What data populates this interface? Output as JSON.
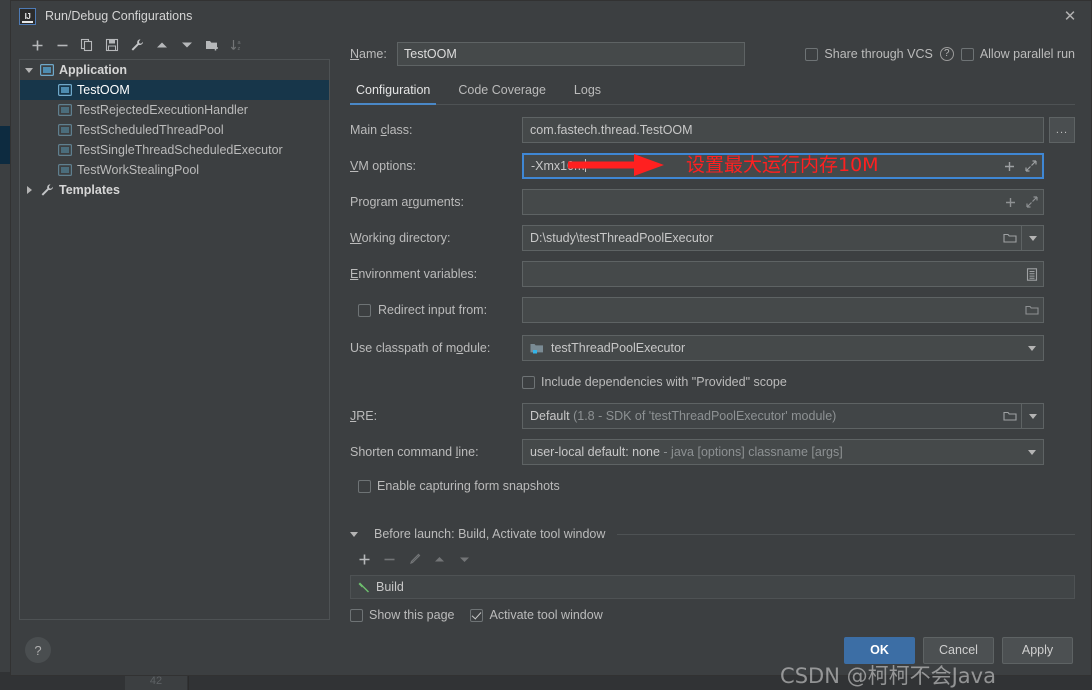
{
  "window": {
    "title": "Run/Debug Configurations",
    "logo_text": "IJ",
    "close_icon": "close-icon"
  },
  "left_toolbar": {
    "buttons": [
      {
        "name": "add-configuration-button",
        "icon": "plus-icon",
        "disabled": false
      },
      {
        "name": "remove-configuration-button",
        "icon": "minus-icon",
        "disabled": false
      },
      {
        "name": "copy-configuration-button",
        "icon": "copy-icon",
        "disabled": false
      },
      {
        "name": "save-configuration-button",
        "icon": "save-icon",
        "disabled": false
      },
      {
        "name": "edit-templates-button",
        "icon": "wrench-icon",
        "disabled": false
      },
      {
        "name": "move-up-button",
        "icon": "arrow-up-icon",
        "disabled": false
      },
      {
        "name": "move-down-button",
        "icon": "arrow-down-icon",
        "disabled": false
      },
      {
        "name": "new-folder-button",
        "icon": "folder-add-icon",
        "disabled": false
      },
      {
        "name": "sort-alphabetically-button",
        "icon": "sort-az-icon",
        "disabled": true
      }
    ]
  },
  "tree": {
    "items": [
      {
        "label": "Application",
        "level": 0,
        "type": "group",
        "expanded": true,
        "selected": false,
        "icon": "application-icon"
      },
      {
        "label": "TestOOM",
        "level": 1,
        "type": "config",
        "selected": true,
        "icon": "application-icon"
      },
      {
        "label": "TestRejectedExecutionHandler",
        "level": 1,
        "type": "config",
        "selected": false,
        "icon": "application-icon"
      },
      {
        "label": "TestScheduledThreadPool",
        "level": 1,
        "type": "config",
        "selected": false,
        "icon": "application-icon"
      },
      {
        "label": "TestSingleThreadScheduledExecutor",
        "level": 1,
        "type": "config",
        "selected": false,
        "icon": "application-icon"
      },
      {
        "label": "TestWorkStealingPool",
        "level": 1,
        "type": "config",
        "selected": false,
        "icon": "application-icon"
      },
      {
        "label": "Templates",
        "level": 0,
        "type": "group",
        "expanded": false,
        "selected": false,
        "icon": "wrench-icon"
      }
    ]
  },
  "name_row": {
    "label": "Name:",
    "value": "TestOOM",
    "share_vcs_label": "Share through VCS",
    "share_vcs_checked": false,
    "help_icon": "question-mark-icon",
    "allow_parallel_label": "Allow parallel run",
    "allow_parallel_checked": false
  },
  "tabs": [
    {
      "label": "Configuration",
      "active": true
    },
    {
      "label": "Code Coverage",
      "active": false
    },
    {
      "label": "Logs",
      "active": false
    }
  ],
  "form": {
    "main_class": {
      "label": "Main class:",
      "value": "com.fastech.thread.TestOOM",
      "browse_label": "..."
    },
    "vm_options": {
      "label": "VM options:",
      "value": "-Xmx10m",
      "focused": true,
      "macro_icon": "plus-icon",
      "expand_icon": "expand-diagonal-icon"
    },
    "program_arguments": {
      "label": "Program arguments:",
      "value": "",
      "macro_icon": "plus-icon",
      "expand_icon": "expand-diagonal-icon"
    },
    "working_directory": {
      "label": "Working directory:",
      "value": "D:\\study\\testThreadPoolExecutor",
      "browse_icon": "folder-icon",
      "dropdown_icon": "chevron-down-icon"
    },
    "environment_variables": {
      "label": "Environment variables:",
      "value": "",
      "browse_icon": "list-edit-icon"
    },
    "redirect_input": {
      "label": "Redirect input from:",
      "checked": false,
      "value": "",
      "browse_icon": "folder-icon"
    },
    "classpath_module": {
      "label": "Use classpath of module:",
      "value": "testThreadPoolExecutor",
      "icon": "module-icon",
      "dropdown_icon": "chevron-down-icon"
    },
    "include_provided": {
      "label": "Include dependencies with \"Provided\" scope",
      "checked": false
    },
    "jre": {
      "label": "JRE:",
      "value": "Default",
      "value_muted": " (1.8 - SDK of 'testThreadPoolExecutor' module)",
      "browse_icon": "folder-icon",
      "dropdown_icon": "chevron-down-icon"
    },
    "shorten_command_line": {
      "label": "Shorten command line:",
      "value": "user-local default: none",
      "value_muted": " - java [options] classname [args]",
      "dropdown_icon": "chevron-down-icon"
    },
    "form_snapshots": {
      "label": "Enable capturing form snapshots",
      "checked": false
    }
  },
  "before_launch": {
    "header": "Before launch: Build, Activate tool window",
    "expanded": true,
    "toolbar": [
      {
        "name": "add-task-button",
        "icon": "plus-icon",
        "disabled": false
      },
      {
        "name": "remove-task-button",
        "icon": "minus-icon",
        "disabled": true
      },
      {
        "name": "edit-task-button",
        "icon": "pencil-icon",
        "disabled": true
      },
      {
        "name": "move-task-up-button",
        "icon": "arrow-up-icon",
        "disabled": true
      },
      {
        "name": "move-task-down-button",
        "icon": "arrow-down-icon",
        "disabled": true
      }
    ],
    "items": [
      {
        "label": "Build",
        "icon": "build-hammer-icon"
      }
    ],
    "show_this_page": {
      "label": "Show this page",
      "checked": false
    },
    "activate_tool_window": {
      "label": "Activate tool window",
      "checked": true
    }
  },
  "footer": {
    "help_icon": "question-mark-icon",
    "ok_label": "OK",
    "cancel_label": "Cancel",
    "apply_label": "Apply"
  },
  "annotation": {
    "text": "设置最大运行内存10M",
    "arrow_color": "#ff2020",
    "text_color": "#ff2020"
  },
  "watermark": {
    "text": "CSDN @柯柯不会Java"
  },
  "background": {
    "line_number": "42"
  },
  "colors": {
    "dialog_bg": "#3c3f41",
    "field_bg": "#45494a",
    "selection_bg": "#17364a",
    "accent_blue": "#4a88c7",
    "primary_button": "#3c6ea5"
  }
}
